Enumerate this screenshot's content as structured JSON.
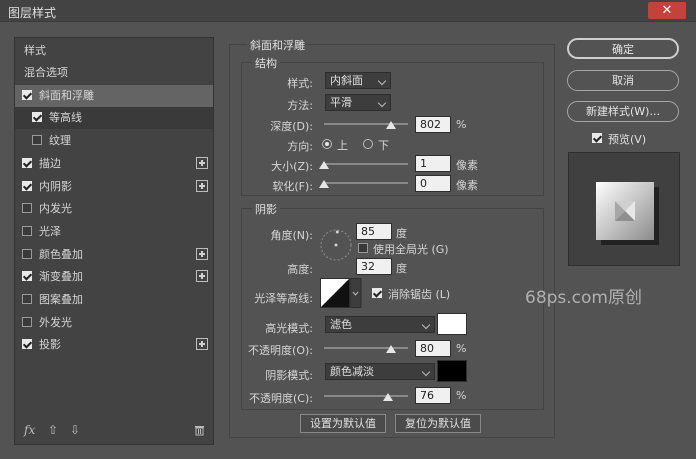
{
  "window": {
    "title": "图层样式"
  },
  "style_list": {
    "header": "样式",
    "items": [
      {
        "label": "混合选项",
        "checkbox": false,
        "checked": false,
        "plus": false
      },
      {
        "label": "斜面和浮雕",
        "checkbox": true,
        "checked": true,
        "plus": false,
        "selected": true
      },
      {
        "label": "等高线",
        "checkbox": true,
        "checked": true,
        "plus": false,
        "sub": true
      },
      {
        "label": "纹理",
        "checkbox": true,
        "checked": false,
        "plus": false,
        "sub": true
      },
      {
        "label": "描边",
        "checkbox": true,
        "checked": true,
        "plus": true
      },
      {
        "label": "内阴影",
        "checkbox": true,
        "checked": true,
        "plus": true
      },
      {
        "label": "内发光",
        "checkbox": true,
        "checked": false,
        "plus": false
      },
      {
        "label": "光泽",
        "checkbox": true,
        "checked": false,
        "plus": false
      },
      {
        "label": "颜色叠加",
        "checkbox": true,
        "checked": false,
        "plus": true
      },
      {
        "label": "渐变叠加",
        "checkbox": true,
        "checked": true,
        "plus": true
      },
      {
        "label": "图案叠加",
        "checkbox": true,
        "checked": false,
        "plus": false
      },
      {
        "label": "外发光",
        "checkbox": true,
        "checked": false,
        "plus": false
      },
      {
        "label": "投影",
        "checkbox": true,
        "checked": true,
        "plus": true
      }
    ],
    "bottom_icons": [
      "fx-icon",
      "arrow-up-icon",
      "arrow-down-icon",
      "trash-icon"
    ],
    "fx_label": "fx"
  },
  "bevel": {
    "title": "斜面和浮雕",
    "structure": {
      "title": "结构",
      "style_label": "样式:",
      "style_value": "内斜面",
      "technique_label": "方法:",
      "technique_value": "平滑",
      "depth_label": "深度(D):",
      "depth_value": "802",
      "depth_unit": "%",
      "depth_fraction": 0.8,
      "direction_label": "方向:",
      "direction_up": "上",
      "direction_down": "下",
      "direction_selected": "上",
      "size_label": "大小(Z):",
      "size_value": "1",
      "size_unit": "像素",
      "size_fraction": 0.0,
      "soften_label": "软化(F):",
      "soften_value": "0",
      "soften_unit": "像素",
      "soften_fraction": 0.0
    },
    "shading": {
      "title": "阴影",
      "angle_label": "角度(N):",
      "angle_value": "85",
      "angle_unit": "度",
      "global_light_label": "使用全局光 (G)",
      "global_light_checked": false,
      "altitude_label": "高度:",
      "altitude_value": "32",
      "altitude_unit": "度",
      "gloss_label": "光泽等高线:",
      "antialias_label": "消除锯齿 (L)",
      "antialias_checked": true,
      "highlight_label": "高光模式:",
      "highlight_value": "滤色",
      "highlight_color": "#ffffff",
      "highlight_opacity_label": "不透明度(O):",
      "highlight_opacity_value": "80",
      "highlight_opacity_unit": "%",
      "highlight_opacity_fraction": 0.8,
      "shadow_label": "阴影模式:",
      "shadow_value": "颜色减淡",
      "shadow_color": "#000000",
      "shadow_opacity_label": "不透明度(C):",
      "shadow_opacity_value": "76",
      "shadow_opacity_unit": "%",
      "shadow_opacity_fraction": 0.76
    },
    "make_default": "设置为默认值",
    "reset_default": "复位为默认值"
  },
  "right": {
    "ok": "确定",
    "cancel": "取消",
    "new_style": "新建样式(W)...",
    "preview_label": "预览(V)",
    "preview_checked": true
  },
  "watermark": "68ps.com原创"
}
